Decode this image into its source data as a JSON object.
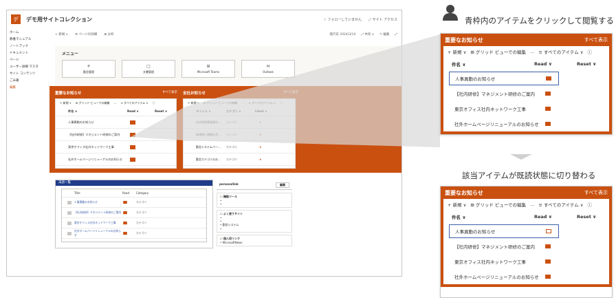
{
  "site": {
    "title": "デモ用サイトコレクション",
    "logo_letter": "デ",
    "top_right": [
      "☆ フォローしていません",
      "⤢ サイト アクセス"
    ],
    "command_left": [
      "+ 新規 ∨",
      "⚙ ページの詳細",
      "⊞ 分析"
    ],
    "command_right": [
      "発行日 2024/3/14",
      "⤢ 共有 ∨",
      "✎ 編集",
      "⤢"
    ]
  },
  "left_nav": [
    "ホーム",
    "教養マニュアル",
    "ノートブック",
    "ドキュメント",
    "ページ",
    "ユーザー詳細 マスタ",
    "サイト コンテンツ",
    "ごみ箱",
    "編集"
  ],
  "menu": {
    "title": "メニュー",
    "tiles": [
      {
        "icon": "✈",
        "label": "勤怠管理"
      },
      {
        "icon": "□",
        "label": "文書管理"
      },
      {
        "icon": "⊞",
        "label": "Microsoft Teams"
      },
      {
        "icon": "✉",
        "label": "Outlook"
      }
    ]
  },
  "small_notice": {
    "title": "重要なお知らせ",
    "see_all": "すべて表示",
    "cmd": [
      "+ 新規 ∨",
      "⊞ グリッド ビューでの編集",
      "…",
      "≡ すべてのアイテム ∨",
      "ⓘ"
    ],
    "cols": [
      "件名 ∨",
      "Read ∨",
      "Reset ∨"
    ],
    "rows": [
      "人事異動のお知らせ",
      "【社内研修】マネジメント研修のご案内",
      "東京オフィス社内ネットワーク工事",
      "社外ホームページリニューアルのお知らせ"
    ]
  },
  "small_all": {
    "title": "全社お知らせ",
    "see_all": "すべて表示",
    "cmd": [
      "+ 新規 ∨",
      "⊞ グリッド ビューでの編集",
      "…",
      "≡ すべてのアイテム ∨",
      "ⓘ"
    ],
    "cols": [
      "タイトル ∨",
      "カテゴリ ∨",
      "Liked ∨"
    ],
    "rows": [
      {
        "title": "社内研修実施案内…",
        "cat": "カテゴリ"
      },
      {
        "title": "新規個人情報の活…",
        "cat": "カテゴリ"
      },
      {
        "title": "勤怠システムバー…",
        "cat": "カテゴリ"
      },
      {
        "title": "勤怠カテゴリのお…",
        "cat": "カテゴリ"
      }
    ]
  },
  "unread": {
    "title": "未読一覧",
    "cols": [
      "Title",
      "Read",
      "Category"
    ],
    "rows": [
      {
        "title": "人事異動のお知らせ",
        "cat": "カテゴリ"
      },
      {
        "title": "【社内研修】マネジメント研修のご案内",
        "cat": "カテゴリ"
      },
      {
        "title": "東京オフィス社内ネットワーク工事",
        "cat": "カテゴリ"
      },
      {
        "title": "社外ホームページリニューアルのお知らせ",
        "cat": "カテゴリ"
      }
    ]
  },
  "personal": {
    "title": "personallink",
    "edit": "編集",
    "sections": [
      {
        "title": "☐ 機能ツール",
        "items": [
          "•",
          "•"
        ]
      },
      {
        "title": "☐ よく使うサイト",
        "items": [
          "•",
          "•",
          "• 勤怠システム",
          "•"
        ]
      },
      {
        "title": "☐ 個人用リンク",
        "items": [
          "• MicrosoftNews"
        ]
      }
    ]
  },
  "caption_top": "青枠内のアイテムをクリックして閲覧する",
  "caption_mid": "該当アイテムが既読状態に切り替わる",
  "big_panel": {
    "title": "重要なお知らせ",
    "see_all": "すべて表示",
    "cmd_new": "+ 新規 ∨",
    "cmd_grid": "⊞ グリッド ビューでの編集",
    "cmd_more": "…",
    "cmd_view": "≡ すべてのアイテム ∨",
    "cmd_info": "ⓘ",
    "col_title": "件名 ∨",
    "col_read": "Read ∨",
    "col_reset": "Reset ∨",
    "rows": [
      "人事異動のお知らせ",
      "【社内研修】マネジメント研修のご案内",
      "東京オフィス社内ネットワーク工事",
      "社外ホームページリニューアルのお知らせ"
    ]
  },
  "colors": {
    "accent": "#ca5010",
    "highlight": "#3a5ea8"
  }
}
